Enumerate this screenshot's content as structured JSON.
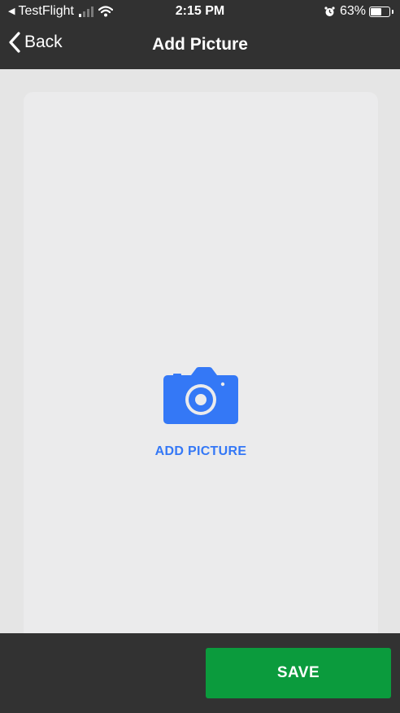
{
  "status_bar": {
    "back_app": "TestFlight",
    "time": "2:15 PM",
    "battery_percent": "63%",
    "battery_level": 0.63,
    "icons": [
      "back-triangle-icon",
      "signal-icon",
      "wifi-icon",
      "alarm-icon",
      "battery-icon"
    ]
  },
  "nav": {
    "back_label": "Back",
    "title": "Add Picture"
  },
  "main": {
    "add_picture_label": "ADD PICTURE",
    "icon": "camera-icon",
    "accent_color": "#3478f6"
  },
  "footer": {
    "save_label": "SAVE",
    "save_color": "#0b9b3d"
  }
}
